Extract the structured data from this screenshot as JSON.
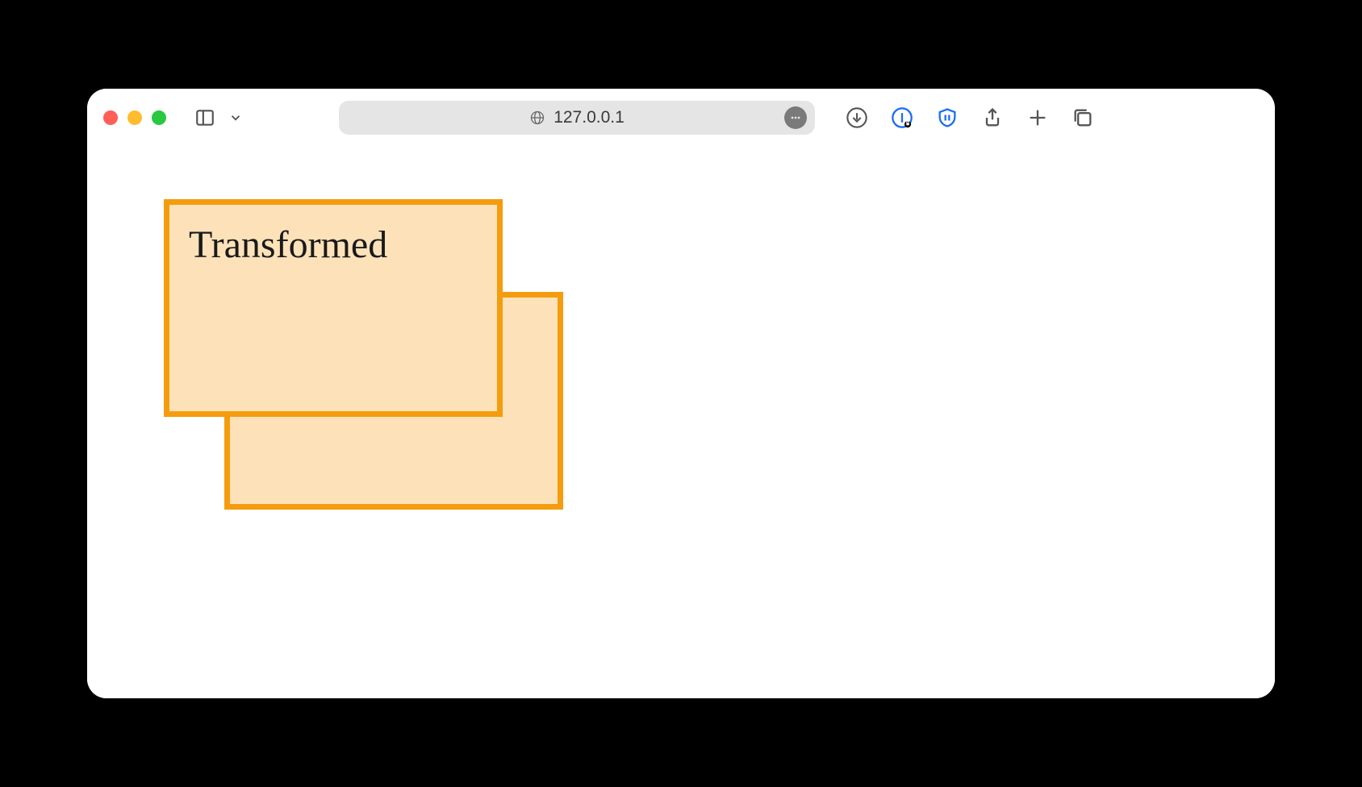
{
  "browser": {
    "url_display": "127.0.0.1"
  },
  "content": {
    "front_box_label": "Transformed"
  },
  "colors": {
    "box_border": "#f59c0e",
    "box_fill": "#fde2b9"
  }
}
